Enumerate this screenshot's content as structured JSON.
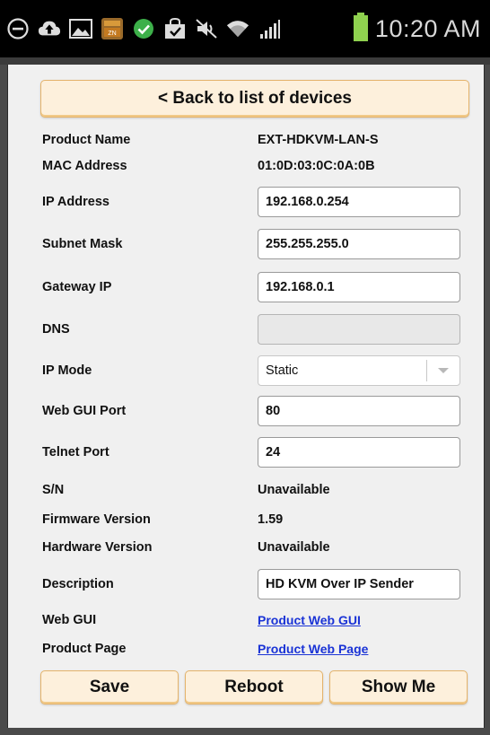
{
  "status_bar": {
    "time": "10:20 AM",
    "icons": [
      "minus-circle-icon",
      "cloud-upload-icon",
      "image-icon",
      "zone-app-icon",
      "check-circle-icon",
      "shopping-bag-icon",
      "mute-icon",
      "wifi-icon",
      "signal-icon",
      "battery-icon"
    ]
  },
  "back_button": {
    "label": "< Back to list of devices"
  },
  "fields": {
    "product_name": {
      "label": "Product Name",
      "value": "EXT-HDKVM-LAN-S"
    },
    "mac_address": {
      "label": "MAC Address",
      "value": "01:0D:03:0C:0A:0B"
    },
    "ip_address": {
      "label": "IP Address",
      "value": "192.168.0.254"
    },
    "subnet_mask": {
      "label": "Subnet Mask",
      "value": "255.255.255.0"
    },
    "gateway_ip": {
      "label": "Gateway IP",
      "value": "192.168.0.1"
    },
    "dns": {
      "label": "DNS",
      "value": ""
    },
    "ip_mode": {
      "label": "IP Mode",
      "value": "Static"
    },
    "web_gui_port": {
      "label": "Web GUI Port",
      "value": "80"
    },
    "telnet_port": {
      "label": "Telnet Port",
      "value": "24"
    },
    "serial": {
      "label": "S/N",
      "value": "Unavailable"
    },
    "firmware": {
      "label": "Firmware Version",
      "value": "1.59"
    },
    "hardware": {
      "label": "Hardware Version",
      "value": "Unavailable"
    },
    "description": {
      "label": "Description",
      "value": "HD KVM Over IP Sender"
    },
    "web_gui": {
      "label": "Web GUI",
      "link": "Product Web GUI"
    },
    "product_page": {
      "label": "Product Page",
      "link": "Product Web Page"
    }
  },
  "actions": {
    "save": "Save",
    "reboot": "Reboot",
    "show_me": "Show Me"
  },
  "colors": {
    "button_bg": "#fdf0dc",
    "button_border": "#e4b36b",
    "link": "#1a33d6",
    "battery": "#8fd14f"
  }
}
